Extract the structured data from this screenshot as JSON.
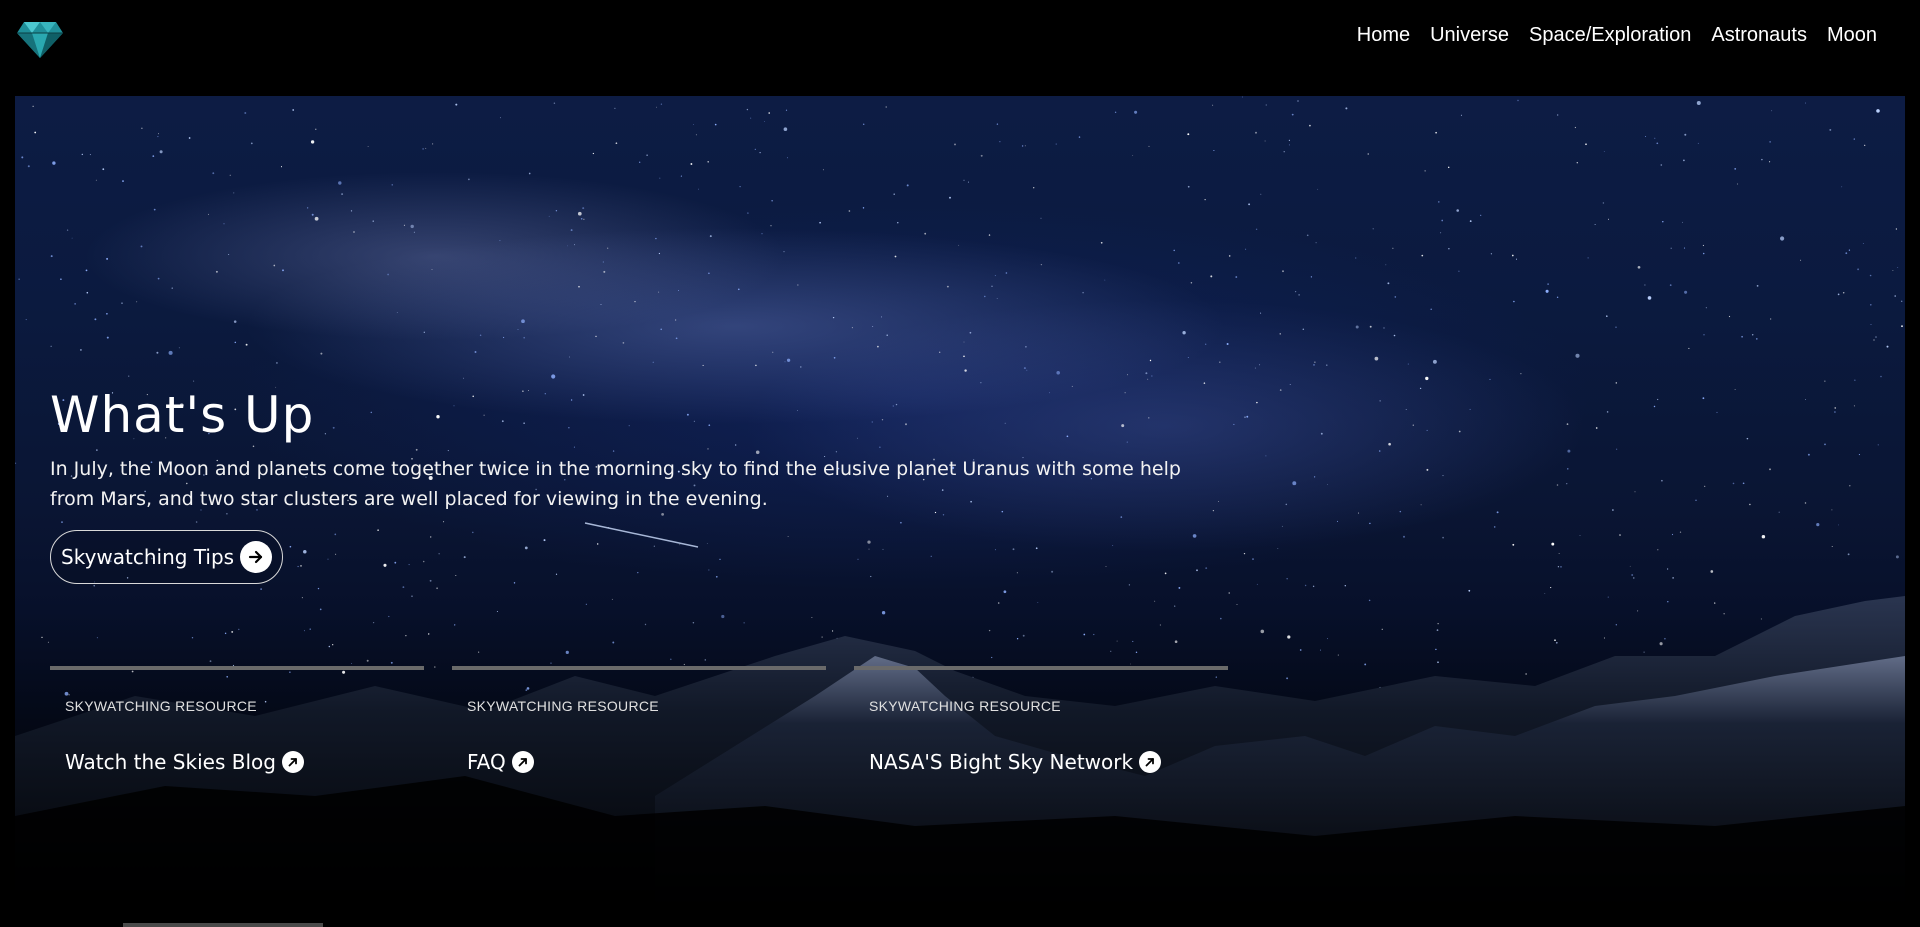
{
  "header": {
    "logo_icon": "diamond-icon",
    "nav": [
      {
        "label": "Home"
      },
      {
        "label": "Universe"
      },
      {
        "label": "Space/Exploration"
      },
      {
        "label": "Astronauts"
      },
      {
        "label": "Moon"
      }
    ]
  },
  "hero": {
    "title": "What's Up",
    "description": "In July, the Moon and planets come together twice in the morning sky to find the elusive planet Uranus with some help from Mars, and two star clusters are well placed for viewing in the evening.",
    "cta_label": "Skywatching Tips",
    "cta_icon": "arrow-right-icon"
  },
  "resources": [
    {
      "kicker": "SKYWATCHING RESOURCE",
      "link": "Watch the Skies Blog",
      "icon": "external-link-icon"
    },
    {
      "kicker": "SKYWATCHING RESOURCE",
      "link": "FAQ",
      "icon": "external-link-icon"
    },
    {
      "kicker": "SKYWATCHING RESOURCE",
      "link": "NASA'S Bight Sky Network",
      "icon": "external-link-icon"
    }
  ],
  "colors": {
    "background": "#000000",
    "logo_teal": "#2aa8b0",
    "text": "#ffffff",
    "divider": "#6a6a6a"
  }
}
